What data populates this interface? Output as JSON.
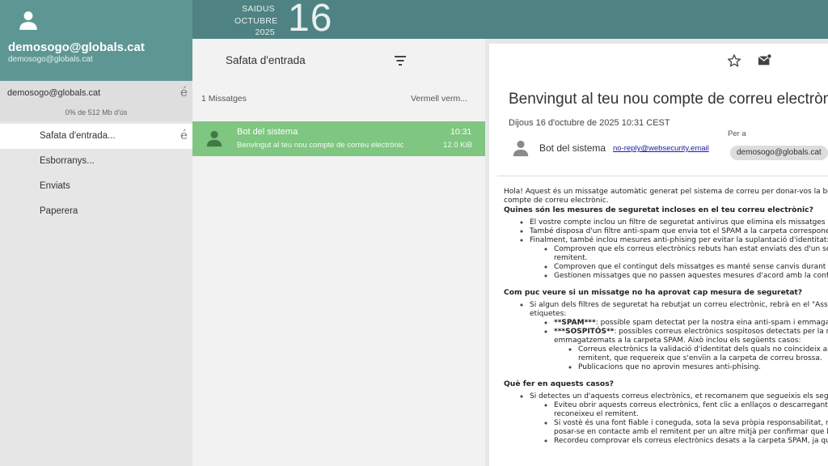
{
  "header": {
    "weekday": "SAIDUS",
    "month": "OCTUBRE",
    "year": "2025",
    "day": "16"
  },
  "sidebar": {
    "account_name": "demosogo@globals.cat",
    "account_sub": "demosogo@globals.cat",
    "account_row_name": "demosogo@globals.cat",
    "usage": "0% de 512 Mb d'ús",
    "edit_glyph": "é",
    "folders": [
      {
        "label": "Safata d'entrada..."
      },
      {
        "label": "Esborranys..."
      },
      {
        "label": "Enviats"
      },
      {
        "label": "Paperera"
      }
    ]
  },
  "list": {
    "title": "Safata d'entrada",
    "count": "1 Missatges",
    "filter_label": "Vermell verm...",
    "messages": [
      {
        "from": "Bot del sistema",
        "subject": "Benvingut al teu nou compte de correu electrònic",
        "time": "10:31",
        "size": "12.0 KiB"
      }
    ]
  },
  "reader": {
    "subject": "Benvingut al teu nou compte de correu electrònic",
    "datetime": "Dijous 16 d'octubre de 2025 10:31 CEST",
    "sender_name": "Bot del sistema",
    "sender_email": "no-reply@websecurity.email",
    "to_label": "Per a",
    "recipient": "demosogo@globals.cat",
    "body": {
      "intro1": "Hola! Aquest és un missatge automàtic generat pel sistema de correu per donar-vos la benvinguda al vostre nou",
      "intro2": "compte de correu electrònic.",
      "h1": "Quines són les mesures de seguretat incloses en el teu correu electrònic?",
      "b1": "El vostre compte inclou un filtre de seguretat antivirus que elimina els missatges amb virus.",
      "b2": "També disposa d'un filtre anti-spam que envia tot el SPAM a la carpeta corresponent.",
      "b3": "Finalment, també inclou mesures anti-phising per evitar la suplantació d'identitat:",
      "b3a1": "Comproven que els correus electrònics rebuts han estat enviats des d'un servidor autoritzat pel",
      "b3a2": "remitent.",
      "b3b": "Comproven que el contingut dels missatges es manté sense canvis durant la transmissió.",
      "b3c": "Gestionen missatges que no passen aquestes mesures d'acord amb la configuració.",
      "h2": "Com puc veure si un missatge no ha aprovat cap mesura de seguretat?",
      "c1a": "Si algun dels filtres de seguretat ha rebutjat un correu electrònic, rebrà en el \"Assumpte\" una de les següents",
      "c1b": "etiquetes:",
      "c1_spam_tag": "**SPAM***",
      "c1_spam_rest": ": possible spam detectat per la nostra eina anti-spam i emmagatzemats a la carpeta SPAM.",
      "c1_susp_tag": "***SOSPITÓS**",
      "c1_susp_rest1": ": possibles correus electrònics sospitosos detectats per la nostra eina anti-phising i",
      "c1_susp_rest2": "emmagatzemats a la carpeta SPAM. Això inclou els següents casos:",
      "c1_case1a": "Correus electrònics la validació d'identitat dels quals no coincideix amb el domini del",
      "c1_case1b": "remitent, que requereix que s'envïin a la carpeta de correu brossa.",
      "c1_case2": "Publicacions que no aprovin mesures anti-phising.",
      "h3": "Què fer en aquests casos?",
      "d1": "Si detectes un d'aquests correus electrònics, et recomanem que segueixis els següents passos:",
      "d1a1": "Eviteu obrir aquests correus electrònics, fent clic a enllaços o descarregant fitxers adjunts si no",
      "d1a2": "reconeixeu el remitent.",
      "d1b1": "Si vostè és una font fiable i coneguda, sota la seva pròpia responsabilitat, recomanem",
      "d1b2": "posar-se en contacte amb el remitent per un altre mitjà per confirmar que l'ha enviat.",
      "d1c": "Recordeu comprovar els correus electrònics desats a la carpeta SPAM, ja que de vegades hi van a parar missatges legítims."
    }
  },
  "colors": {
    "sidebar_header": "#5e9694",
    "topbar": "#4f8383",
    "selected_message": "#7fc681",
    "sidebar_bg": "#e6e6e6",
    "list_bg": "#f2f2f2"
  },
  "icons": [
    "user-icon",
    "filter-icon",
    "star-icon",
    "mail-action-icon",
    "edit-icon"
  ]
}
